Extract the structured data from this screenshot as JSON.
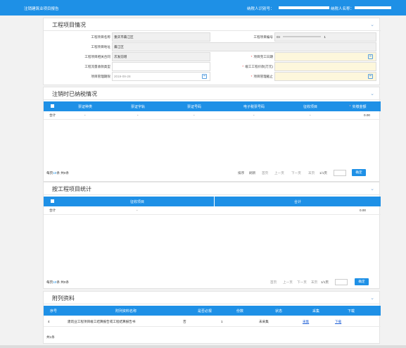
{
  "header": {
    "title": "注销建筑业项目报告",
    "tax_id_label": "纳税人识别号：",
    "taxpayer_name_label": "纳税人名称："
  },
  "project_section": {
    "title": "工程项目情况",
    "fields": {
      "project_name_label": "工程项目名称",
      "project_name_value": "重庆市綦江区",
      "project_no_label": "工程项目编号",
      "project_no_value": "GI",
      "project_no_tail": "1",
      "project_addr_label": "工程项目地址",
      "project_addr_value": "綦江区",
      "contract_label": "工程项目相关合同",
      "contract_value": "次发前增",
      "finish_date_label": "项目完工日期",
      "billing_type_label": "工程流量收款类型",
      "total_amount_label": "竣工工程价款(万元)",
      "start_date_label": "项目管理期限",
      "start_date_value": "2019-09-28",
      "stop_date_label": "项目管理截止"
    }
  },
  "tax_section": {
    "title": "注销时已纳税情况",
    "columns": [
      "票证种类",
      "票证字轨",
      "票证号码",
      "电子税票号码",
      "征收项目",
      "实缴金额"
    ],
    "total_row": [
      "合计",
      "-",
      "-",
      "-",
      "-",
      "-",
      "0.00"
    ],
    "pager": {
      "info_prefix": "每页",
      "info_count": "10",
      "info_suffix": "条 共0条",
      "first": "首页",
      "prev": "上一页",
      "next": "下一页",
      "last": "末页",
      "page": "1/1页",
      "sort_label": "排序",
      "refresh_label": "刷新",
      "go_button": "确定"
    }
  },
  "stats_section": {
    "title": "按工程项目统计",
    "columns": [
      "征收项目",
      "合计"
    ],
    "total_row": [
      "合计",
      "-",
      "0.00"
    ],
    "pager": {
      "info_prefix": "每页",
      "info_count": "10",
      "info_suffix": "条 共0条",
      "first": "首页",
      "prev": "上一页",
      "next": "下一页",
      "last": "末页",
      "page": "1/1页",
      "go_button": "确定"
    }
  },
  "attach_section": {
    "title": "附列资料",
    "columns": [
      "序号",
      "附列资料名称",
      "是否必报",
      "份数",
      "状态",
      "采集",
      "下载"
    ],
    "rows": [
      {
        "index": "4",
        "name": "建筑业工程项目竣工结算报告或工程结算报告书",
        "required": "否",
        "count": "1",
        "status": "未采集",
        "collect": "采集",
        "download": "下载"
      }
    ],
    "footer": "共1条"
  },
  "colors": {
    "primary": "#1e90e6",
    "required_yellow": "#fdf7dc"
  }
}
